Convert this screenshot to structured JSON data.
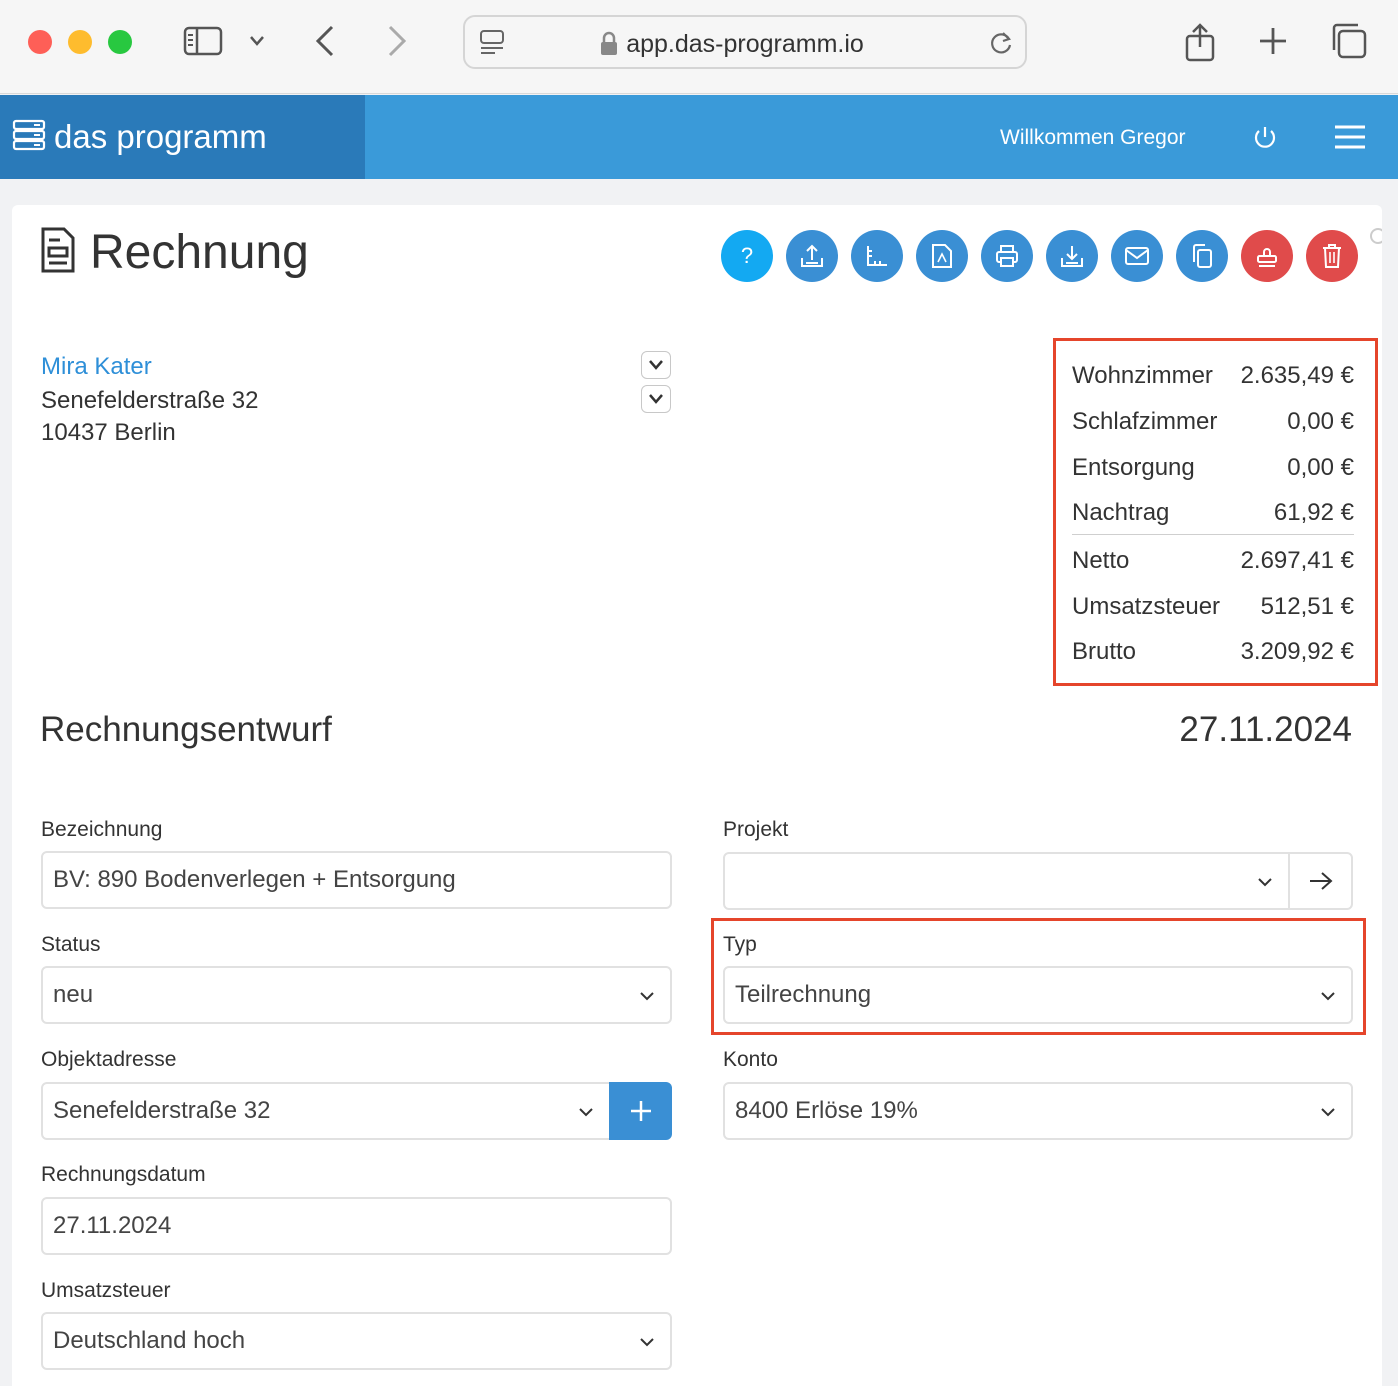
{
  "browser": {
    "url": "app.das-programm.io"
  },
  "app": {
    "brand": "das programm",
    "welcome": "Willkommen Gregor"
  },
  "page": {
    "title": "Rechnung",
    "help_label": "?"
  },
  "customer": {
    "name": "Mira Kater",
    "street": "Senefelderstraße 32",
    "city": "10437 Berlin"
  },
  "totals": {
    "rows": [
      {
        "label": "Wohnzimmer",
        "value": "2.635,49 €"
      },
      {
        "label": "Schlafzimmer",
        "value": "0,00 €"
      },
      {
        "label": "Entsorgung",
        "value": "0,00 €"
      },
      {
        "label": "Nachtrag",
        "value": "61,92 €"
      },
      {
        "label": "Netto",
        "value": "2.697,41 €"
      },
      {
        "label": "Umsatzsteuer",
        "value": "512,51 €"
      },
      {
        "label": "Brutto",
        "value": "3.209,92 €"
      }
    ]
  },
  "draft": {
    "title": "Rechnungsentwurf",
    "date": "27.11.2024"
  },
  "form": {
    "bezeichnung": {
      "label": "Bezeichnung",
      "value": "BV: 890 Bodenverlegen + Entsorgung"
    },
    "status": {
      "label": "Status",
      "value": "neu"
    },
    "objektadresse": {
      "label": "Objektadresse",
      "value": "Senefelderstraße 32"
    },
    "rechnungsdatum": {
      "label": "Rechnungsdatum",
      "value": "27.11.2024"
    },
    "umsatzsteuer": {
      "label": "Umsatzsteuer",
      "value": "Deutschland hoch"
    },
    "projekt": {
      "label": "Projekt",
      "value": ""
    },
    "typ": {
      "label": "Typ",
      "value": "Teilrechnung"
    },
    "konto": {
      "label": "Konto",
      "value": "8400 Erlöse 19%"
    }
  },
  "colors": {
    "primary": "#3a9ad9",
    "brand_dark": "#2a7ab9",
    "danger": "#e04b4b",
    "highlight": "#e5452b",
    "link": "#2e8fd8"
  },
  "icons": {
    "toolbar": [
      "help-icon",
      "upload-icon",
      "measure-icon",
      "pdf-icon",
      "print-icon",
      "download-icon",
      "mail-icon",
      "copy-icon",
      "stamp-icon",
      "trash-icon"
    ]
  }
}
